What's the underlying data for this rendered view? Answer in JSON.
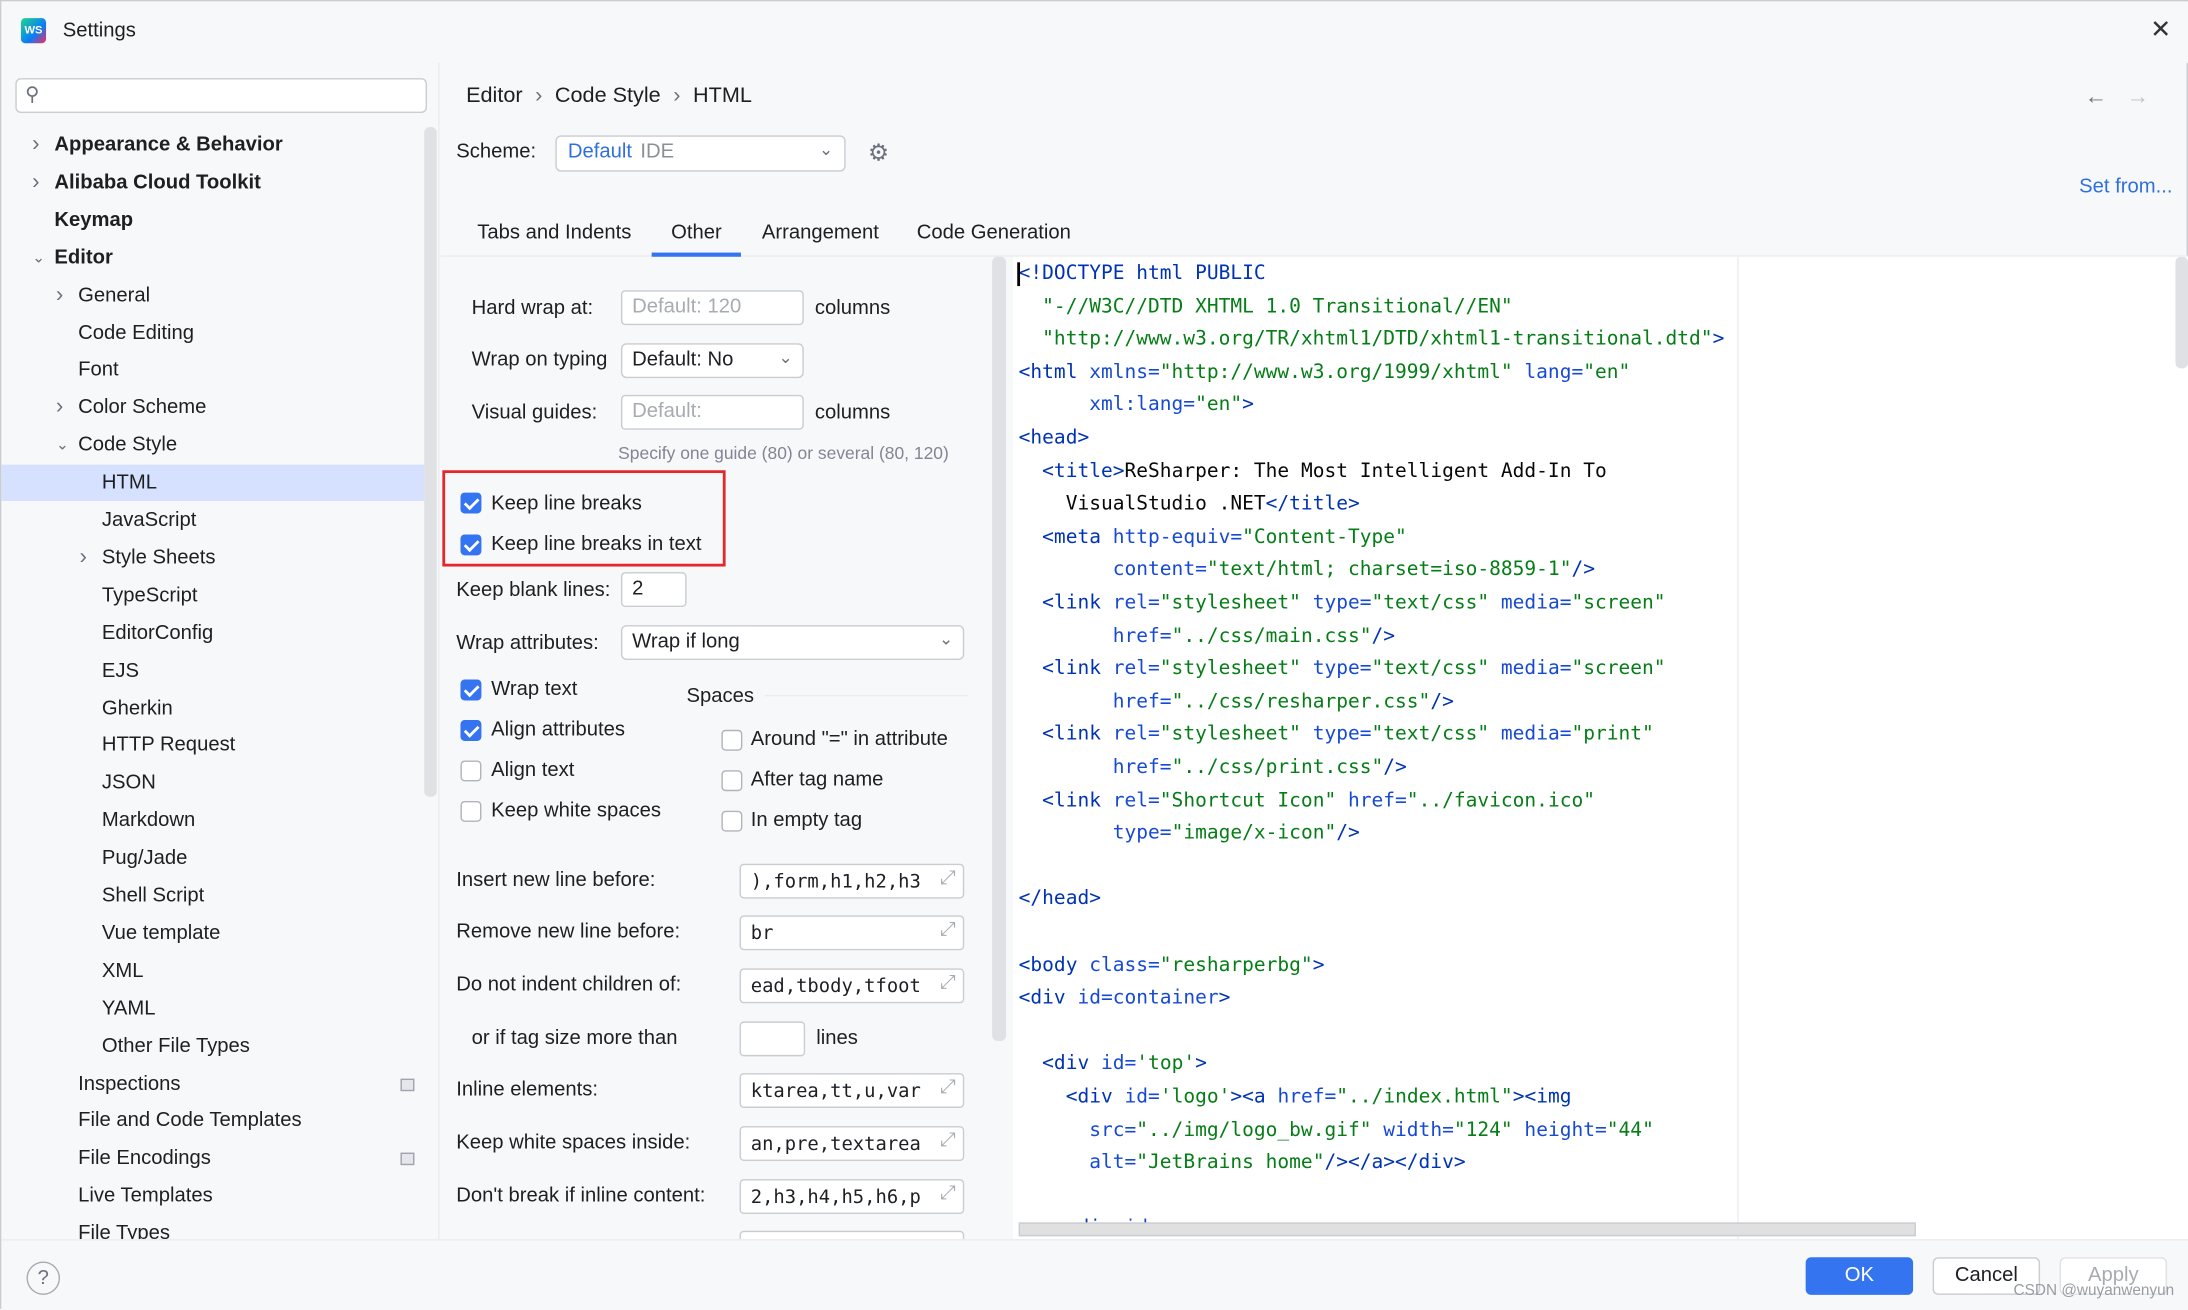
{
  "window": {
    "title": "Settings",
    "logo": "WS",
    "close_icon": "close-icon"
  },
  "sidebar": {
    "search_placeholder": "",
    "items": [
      {
        "label": "Appearance & Behavior",
        "level": 0,
        "chevron": "right",
        "top": true
      },
      {
        "label": "Alibaba Cloud Toolkit",
        "level": 0,
        "chevron": "right",
        "top": true
      },
      {
        "label": "Keymap",
        "level": 0,
        "chevron": "",
        "top": true
      },
      {
        "label": "Editor",
        "level": 0,
        "chevron": "down",
        "top": true
      },
      {
        "label": "General",
        "level": 1,
        "chevron": "right"
      },
      {
        "label": "Code Editing",
        "level": 1,
        "chevron": ""
      },
      {
        "label": "Font",
        "level": 1,
        "chevron": ""
      },
      {
        "label": "Color Scheme",
        "level": 1,
        "chevron": "right"
      },
      {
        "label": "Code Style",
        "level": 1,
        "chevron": "down"
      },
      {
        "label": "HTML",
        "level": 2,
        "chevron": "",
        "selected": true
      },
      {
        "label": "JavaScript",
        "level": 2,
        "chevron": ""
      },
      {
        "label": "Style Sheets",
        "level": 2,
        "chevron": "right"
      },
      {
        "label": "TypeScript",
        "level": 2,
        "chevron": ""
      },
      {
        "label": "EditorConfig",
        "level": 2,
        "chevron": ""
      },
      {
        "label": "EJS",
        "level": 2,
        "chevron": ""
      },
      {
        "label": "Gherkin",
        "level": 2,
        "chevron": ""
      },
      {
        "label": "HTTP Request",
        "level": 2,
        "chevron": ""
      },
      {
        "label": "JSON",
        "level": 2,
        "chevron": ""
      },
      {
        "label": "Markdown",
        "level": 2,
        "chevron": ""
      },
      {
        "label": "Pug/Jade",
        "level": 2,
        "chevron": ""
      },
      {
        "label": "Shell Script",
        "level": 2,
        "chevron": ""
      },
      {
        "label": "Vue template",
        "level": 2,
        "chevron": ""
      },
      {
        "label": "XML",
        "level": 2,
        "chevron": ""
      },
      {
        "label": "YAML",
        "level": 2,
        "chevron": ""
      },
      {
        "label": "Other File Types",
        "level": 2,
        "chevron": ""
      },
      {
        "label": "Inspections",
        "level": 1,
        "chevron": "",
        "badge": true
      },
      {
        "label": "File and Code Templates",
        "level": 1,
        "chevron": ""
      },
      {
        "label": "File Encodings",
        "level": 1,
        "chevron": "",
        "badge": true
      },
      {
        "label": "Live Templates",
        "level": 1,
        "chevron": ""
      },
      {
        "label": "File Types",
        "level": 1,
        "chevron": ""
      }
    ]
  },
  "breadcrumb": [
    "Editor",
    "Code Style",
    "HTML"
  ],
  "scheme": {
    "label": "Scheme:",
    "name": "Default",
    "type": "IDE",
    "set_from": "Set from..."
  },
  "tabs": [
    {
      "label": "Tabs and Indents"
    },
    {
      "label": "Other",
      "active": true
    },
    {
      "label": "Arrangement"
    },
    {
      "label": "Code Generation"
    }
  ],
  "other": {
    "hard_wrap": {
      "label": "Hard wrap at:",
      "placeholder": "Default: 120",
      "suffix": "columns"
    },
    "wrap_on_typing": {
      "label": "Wrap on typing",
      "value": "Default: No"
    },
    "visual_guides": {
      "label": "Visual guides:",
      "placeholder": "Default:",
      "suffix": "columns",
      "hint": "Specify one guide (80) or several (80, 120)"
    },
    "keep_line_breaks": {
      "label": "Keep line breaks",
      "checked": true
    },
    "keep_line_breaks_text": {
      "label": "Keep line breaks in text",
      "checked": true
    },
    "keep_blank_lines": {
      "label": "Keep blank lines:",
      "value": "2"
    },
    "wrap_attributes": {
      "label": "Wrap attributes:",
      "value": "Wrap if long"
    },
    "wrap_text": {
      "label": "Wrap text",
      "checked": true
    },
    "align_attributes": {
      "label": "Align attributes",
      "checked": true
    },
    "align_text": {
      "label": "Align text",
      "checked": false
    },
    "keep_white_spaces": {
      "label": "Keep white spaces",
      "checked": false
    },
    "spaces_header": "Spaces",
    "around_eq": {
      "label": "Around \"=\" in attribute",
      "checked": false
    },
    "after_tag_name": {
      "label": "After tag name",
      "checked": false
    },
    "in_empty_tag": {
      "label": "In empty tag",
      "checked": false
    },
    "insert_new_line": {
      "label": "Insert new line before:",
      "value": "),form,h1,h2,h3"
    },
    "remove_new_line": {
      "label": "Remove new line before:",
      "value": "br"
    },
    "no_indent_children": {
      "label": "Do not indent children of:",
      "value": "ead,tbody,tfoot"
    },
    "tag_size": {
      "label": "or if tag size more than",
      "value": "",
      "suffix": "lines"
    },
    "inline_elements": {
      "label": "Inline elements:",
      "value": "ktarea,tt,u,var"
    },
    "keep_ws_inside": {
      "label": "Keep white spaces inside:",
      "value": "an,pre,textarea"
    },
    "dont_break_inline": {
      "label": "Don't break if inline content:",
      "value": "2,h3,h4,h5,h6,p"
    }
  },
  "code_preview": [
    [
      [
        0,
        ""
      ],
      [
        "tag",
        "<!DOCTYPE html PUBLIC"
      ]
    ],
    [
      [
        2,
        ""
      ],
      [
        "val",
        "\"-//W3C//DTD XHTML 1.0 Transitional//EN\""
      ]
    ],
    [
      [
        2,
        ""
      ],
      [
        "val",
        "\"http://www.w3.org/TR/xhtml1/DTD/xhtml1-transitional.dtd\""
      ],
      [
        "tag",
        ">"
      ]
    ],
    [
      [
        0,
        ""
      ],
      [
        "tag",
        "<html "
      ],
      [
        "attr",
        "xmlns="
      ],
      [
        "val",
        "\"http://www.w3.org/1999/xhtml\" "
      ],
      [
        "attr",
        "lang="
      ],
      [
        "val",
        "\"en\""
      ]
    ],
    [
      [
        6,
        ""
      ],
      [
        "attr",
        "xml:lang="
      ],
      [
        "val",
        "\"en\""
      ],
      [
        "tag",
        ">"
      ]
    ],
    [
      [
        0,
        ""
      ],
      [
        "tag",
        "<head>"
      ]
    ],
    [
      [
        2,
        ""
      ],
      [
        "tag",
        "<title>"
      ],
      [
        "txt",
        "ReSharper: The Most Intelligent Add-In To"
      ]
    ],
    [
      [
        4,
        ""
      ],
      [
        "txt",
        "VisualStudio .NET"
      ],
      [
        "tag",
        "</title>"
      ]
    ],
    [
      [
        2,
        ""
      ],
      [
        "tag",
        "<meta "
      ],
      [
        "attr",
        "http-equiv="
      ],
      [
        "val",
        "\"Content-Type\""
      ]
    ],
    [
      [
        8,
        ""
      ],
      [
        "attr",
        "content="
      ],
      [
        "val",
        "\"text/html; charset=iso-8859-1\""
      ],
      [
        "tag",
        "/>"
      ]
    ],
    [
      [
        2,
        ""
      ],
      [
        "tag",
        "<link "
      ],
      [
        "attr",
        "rel="
      ],
      [
        "val",
        "\"stylesheet\" "
      ],
      [
        "attr",
        "type="
      ],
      [
        "val",
        "\"text/css\" "
      ],
      [
        "attr",
        "media="
      ],
      [
        "val",
        "\"screen\""
      ]
    ],
    [
      [
        8,
        ""
      ],
      [
        "attr",
        "href="
      ],
      [
        "val",
        "\"../css/main.css\""
      ],
      [
        "tag",
        "/>"
      ]
    ],
    [
      [
        2,
        ""
      ],
      [
        "tag",
        "<link "
      ],
      [
        "attr",
        "rel="
      ],
      [
        "val",
        "\"stylesheet\" "
      ],
      [
        "attr",
        "type="
      ],
      [
        "val",
        "\"text/css\" "
      ],
      [
        "attr",
        "media="
      ],
      [
        "val",
        "\"screen\""
      ]
    ],
    [
      [
        8,
        ""
      ],
      [
        "attr",
        "href="
      ],
      [
        "val",
        "\"../css/resharper.css\""
      ],
      [
        "tag",
        "/>"
      ]
    ],
    [
      [
        2,
        ""
      ],
      [
        "tag",
        "<link "
      ],
      [
        "attr",
        "rel="
      ],
      [
        "val",
        "\"stylesheet\" "
      ],
      [
        "attr",
        "type="
      ],
      [
        "val",
        "\"text/css\" "
      ],
      [
        "attr",
        "media="
      ],
      [
        "val",
        "\"print\""
      ]
    ],
    [
      [
        8,
        ""
      ],
      [
        "attr",
        "href="
      ],
      [
        "val",
        "\"../css/print.css\""
      ],
      [
        "tag",
        "/>"
      ]
    ],
    [
      [
        2,
        ""
      ],
      [
        "tag",
        "<link "
      ],
      [
        "attr",
        "rel="
      ],
      [
        "val",
        "\"Shortcut Icon\" "
      ],
      [
        "attr",
        "href="
      ],
      [
        "val",
        "\"../favicon.ico\""
      ]
    ],
    [
      [
        8,
        ""
      ],
      [
        "attr",
        "type="
      ],
      [
        "val",
        "\"image/x-icon\""
      ],
      [
        "tag",
        "/>"
      ]
    ],
    [],
    [
      [
        0,
        ""
      ],
      [
        "tag",
        "</head>"
      ]
    ],
    [],
    [
      [
        0,
        ""
      ],
      [
        "tag",
        "<body "
      ],
      [
        "attr",
        "class="
      ],
      [
        "val",
        "\"resharperbg\""
      ],
      [
        "tag",
        ">"
      ]
    ],
    [
      [
        0,
        ""
      ],
      [
        "tag",
        "<div "
      ],
      [
        "attr",
        "id=container"
      ],
      [
        "tag",
        ">"
      ]
    ],
    [],
    [
      [
        2,
        ""
      ],
      [
        "tag",
        "<div "
      ],
      [
        "attr",
        "id="
      ],
      [
        "val",
        "'top'"
      ],
      [
        "tag",
        ">"
      ]
    ],
    [
      [
        4,
        ""
      ],
      [
        "tag",
        "<div "
      ],
      [
        "attr",
        "id="
      ],
      [
        "val",
        "'logo'"
      ],
      [
        "tag",
        "><a "
      ],
      [
        "attr",
        "href="
      ],
      [
        "val",
        "\"../index.html\""
      ],
      [
        "tag",
        "><img"
      ]
    ],
    [
      [
        6,
        ""
      ],
      [
        "attr",
        "src="
      ],
      [
        "val",
        "\"../img/logo_bw.gif\" "
      ],
      [
        "attr",
        "width="
      ],
      [
        "val",
        "\"124\" "
      ],
      [
        "attr",
        "height="
      ],
      [
        "val",
        "\"44\""
      ]
    ],
    [
      [
        6,
        ""
      ],
      [
        "attr",
        "alt="
      ],
      [
        "val",
        "\"JetBrains home\""
      ],
      [
        "tag",
        "/></a></div>"
      ]
    ],
    [],
    [
      [
        4,
        ""
      ],
      [
        "tag",
        "<div "
      ],
      [
        "attr",
        "id=nav"
      ],
      [
        "tag",
        ">"
      ]
    ]
  ],
  "footer": {
    "ok": "OK",
    "cancel": "Cancel",
    "apply": "Apply",
    "help": "?",
    "watermark": "CSDN @wuyanwenyun"
  },
  "colors": {
    "accent": "#3574f0",
    "selection": "#d5e1ff",
    "highlight_box": "#e5262b",
    "tag": "#0033b3",
    "attr": "#174ad4",
    "value": "#067d17"
  }
}
